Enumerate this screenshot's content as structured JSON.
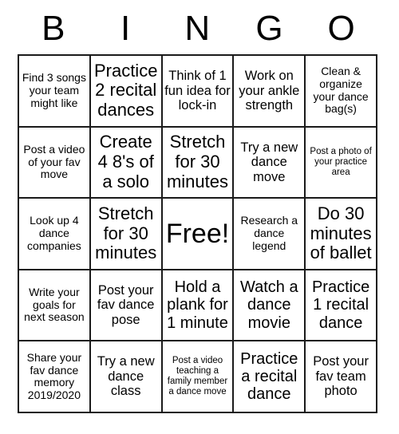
{
  "card": {
    "title_letters": [
      "B",
      "I",
      "N",
      "G",
      "O"
    ],
    "border_color": "#1a1a1a",
    "background_color": "#ffffff",
    "text_color": "#000000",
    "rows": 5,
    "columns": 5,
    "cells": [
      [
        {
          "text": "Find 3 songs your team might like",
          "size": "s"
        },
        {
          "text": "Practice 2 recital dances",
          "size": "xl"
        },
        {
          "text": "Think of 1 fun idea for lock-in",
          "size": "m"
        },
        {
          "text": "Work on your ankle strength",
          "size": "m"
        },
        {
          "text": "Clean & organize your dance bag(s)",
          "size": "s"
        }
      ],
      [
        {
          "text": "Post a video of your fav move",
          "size": "s"
        },
        {
          "text": "Create 4 8's of a solo",
          "size": "xl"
        },
        {
          "text": "Stretch for 30 minutes",
          "size": "xl"
        },
        {
          "text": "Try a new dance move",
          "size": "m"
        },
        {
          "text": "Post a photo of your practice area",
          "size": "xs"
        }
      ],
      [
        {
          "text": "Look up 4 dance companies",
          "size": "s"
        },
        {
          "text": "Stretch for 30 minutes",
          "size": "xl"
        },
        {
          "text": "Free!",
          "size": "free"
        },
        {
          "text": "Research a dance legend",
          "size": "s"
        },
        {
          "text": "Do 30 minutes of ballet",
          "size": "xl"
        }
      ],
      [
        {
          "text": "Write your goals for next season",
          "size": "s"
        },
        {
          "text": "Post your fav dance pose",
          "size": "m"
        },
        {
          "text": "Hold a plank for 1 minute",
          "size": "l"
        },
        {
          "text": "Watch a dance movie",
          "size": "l"
        },
        {
          "text": "Practice 1 recital dance",
          "size": "l"
        }
      ],
      [
        {
          "text": "Share your fav dance memory 2019/2020",
          "size": "s"
        },
        {
          "text": "Try a new dance class",
          "size": "m"
        },
        {
          "text": "Post a video teaching a family member a dance move",
          "size": "xs"
        },
        {
          "text": "Practice a recital dance",
          "size": "l"
        },
        {
          "text": "Post your fav team photo",
          "size": "m"
        }
      ]
    ]
  }
}
